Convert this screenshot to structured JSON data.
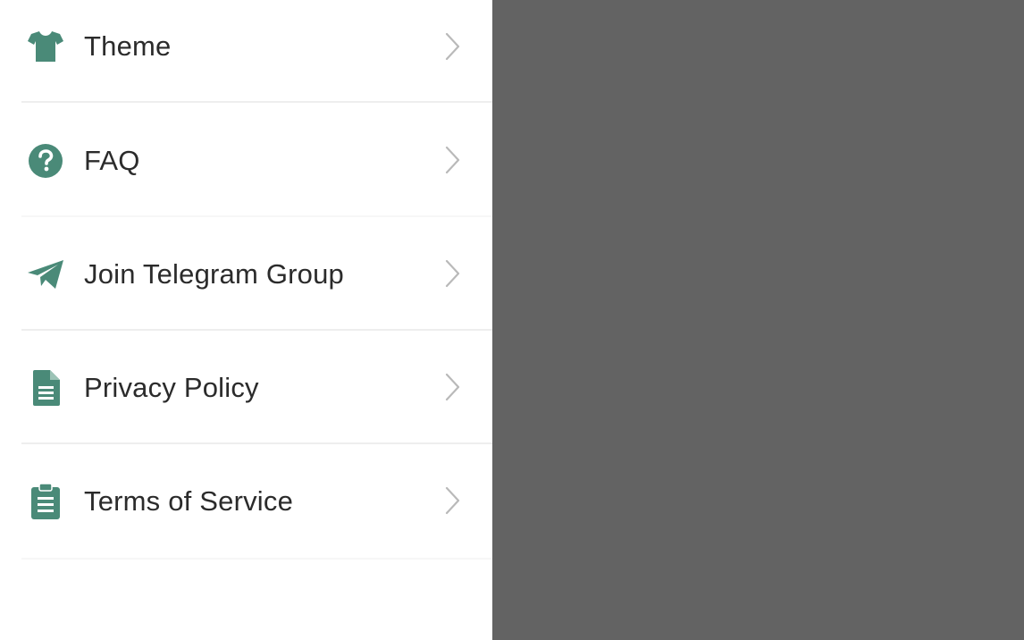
{
  "drawer": {
    "accent_color": "#4a8a78",
    "items": [
      {
        "label": "Theme",
        "icon": "tshirt-icon"
      },
      {
        "label": "FAQ",
        "icon": "question-circle-icon"
      },
      {
        "label": "Join Telegram Group",
        "icon": "telegram-plane-icon"
      },
      {
        "label": "Privacy Policy",
        "icon": "document-icon"
      },
      {
        "label": "Terms of Service",
        "icon": "clipboard-icon"
      }
    ]
  },
  "scrim": {
    "color": "#636363"
  }
}
